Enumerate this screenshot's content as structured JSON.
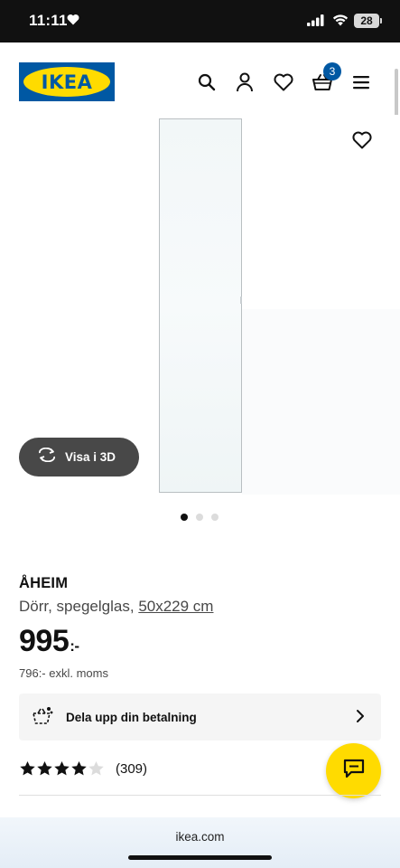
{
  "status_bar": {
    "time": "11:11",
    "battery": "28"
  },
  "header": {
    "logo_text": "IKEA",
    "basket_count": "3",
    "icons": [
      "search-icon",
      "account-icon",
      "heart-icon",
      "basket-icon",
      "menu-icon"
    ]
  },
  "gallery": {
    "view_3d_label": "Visa i 3D",
    "dots": 3,
    "active_dot": 0
  },
  "product": {
    "name": "ÅHEIM",
    "description": "Dörr, spegelglas,",
    "size": "50x229 cm",
    "price": "995",
    "price_suffix": ":-",
    "price_excl": "796:- exkl. moms"
  },
  "payment": {
    "label": "Dela upp din betalning"
  },
  "rating": {
    "stars": 4,
    "max_stars": 5,
    "count": "(309)"
  },
  "browser": {
    "url": "ikea.com"
  },
  "colors": {
    "ikea_blue": "#0058a3",
    "ikea_yellow": "#ffdb00",
    "dark_button": "#484848"
  }
}
